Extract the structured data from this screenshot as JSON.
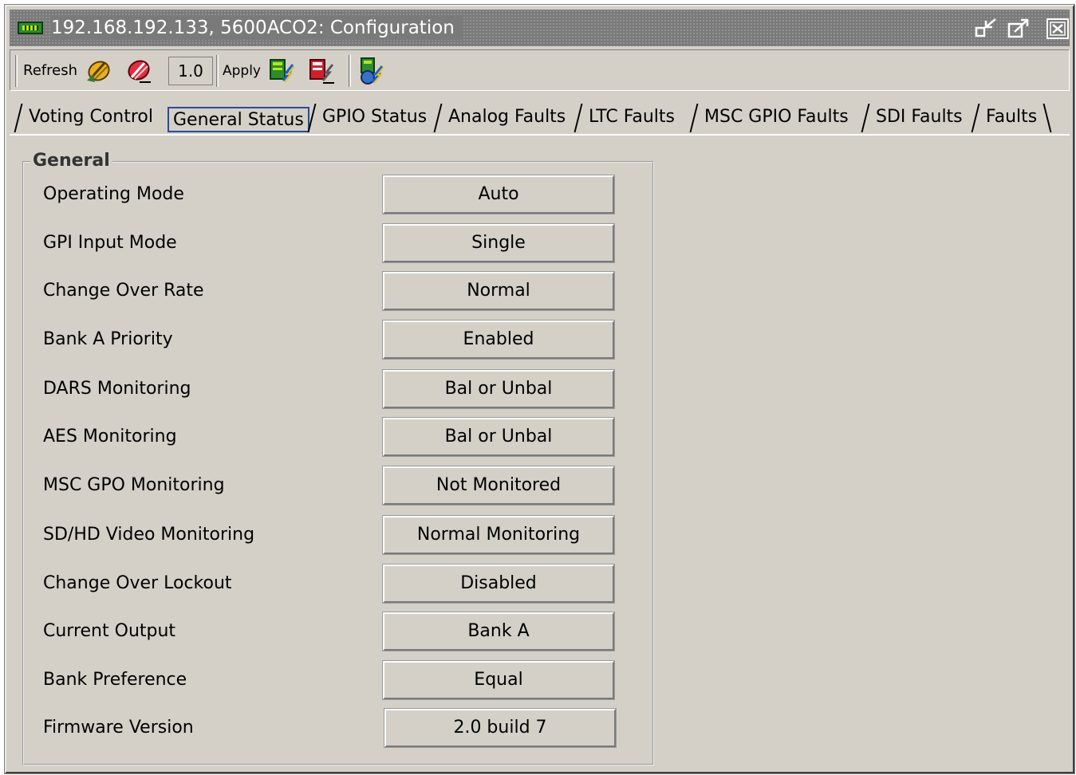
{
  "window": {
    "title": "192.168.192.133, 5600ACO2: Configuration",
    "icon": "circuit-board-icon",
    "controls": [
      "unpin-icon",
      "maximize-icon",
      "close-icon"
    ]
  },
  "toolbar": {
    "refresh_label": "Refresh",
    "version": "1.0",
    "apply_label": "Apply",
    "icons": [
      "refresh-all-icon",
      "refresh-cancel-icon",
      "apply-card-icon",
      "revert-card-icon",
      "upload-network-icon"
    ]
  },
  "tabs": [
    {
      "label": "Voting Control",
      "active": false
    },
    {
      "label": "General Status",
      "active": true
    },
    {
      "label": "GPIO Status",
      "active": false
    },
    {
      "label": "Analog Faults",
      "active": false
    },
    {
      "label": "LTC Faults",
      "active": false
    },
    {
      "label": "MSC GPIO Faults",
      "active": false
    },
    {
      "label": "SDI Faults",
      "active": false
    },
    {
      "label": "Faults",
      "active": false
    }
  ],
  "general": {
    "title": "General",
    "rows": [
      {
        "label": "Operating Mode",
        "value": "Auto"
      },
      {
        "label": "GPI Input Mode",
        "value": "Single"
      },
      {
        "label": "Change Over Rate",
        "value": "Normal"
      },
      {
        "label": "Bank A Priority",
        "value": "Enabled"
      },
      {
        "label": "DARS Monitoring",
        "value": "Bal or Unbal"
      },
      {
        "label": "AES Monitoring",
        "value": "Bal or Unbal"
      },
      {
        "label": "MSC GPO Monitoring",
        "value": "Not Monitored"
      },
      {
        "label": "SD/HD Video Monitoring",
        "value": "Normal Monitoring"
      },
      {
        "label": "Change Over Lockout",
        "value": "Disabled"
      },
      {
        "label": "Current Output",
        "value": "Bank A"
      },
      {
        "label": "Bank Preference",
        "value": "Equal"
      },
      {
        "label": "Firmware Version",
        "value": "2.0 build 7"
      }
    ]
  },
  "colors": {
    "window_bg": "#d4d0c8",
    "titlebar_bg": "#7a7a7a",
    "active_tab_border": "#2c4a9a"
  }
}
